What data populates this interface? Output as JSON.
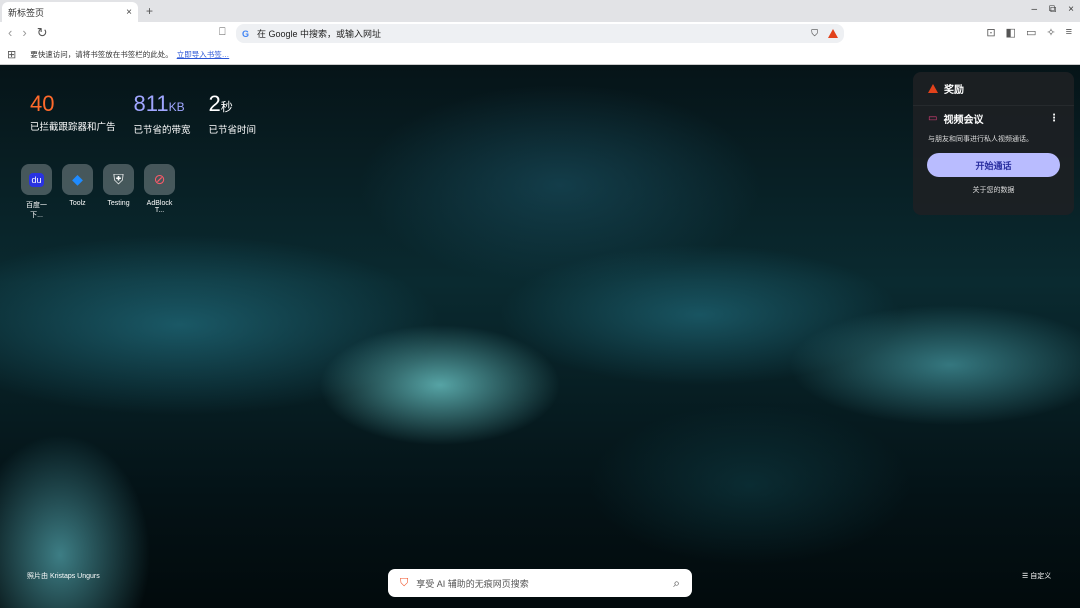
{
  "tab": {
    "title": "新标签页",
    "close": "×",
    "new": "+"
  },
  "window": {
    "min": "–",
    "restore": "⧉",
    "close": "×"
  },
  "omnibox": {
    "placeholder": "在 Google 中搜索，或输入网址",
    "g": "G"
  },
  "bookmarks": {
    "hint": "要快速访问，请将书签放在书签栏的此处。",
    "import": "立即导入书签…"
  },
  "stats": [
    {
      "value": "40",
      "unit": "",
      "label": "已拦截跟踪器和广告",
      "color": "#ff6a2b"
    },
    {
      "value": "811",
      "unit": "KB",
      "label": "已节省的带宽",
      "color": "#a0a6ff"
    },
    {
      "value": "2",
      "unit": "秒",
      "label": "已节省时间",
      "color": "#ffffff"
    }
  ],
  "tiles": [
    {
      "label": "百度一下...",
      "icon": "du"
    },
    {
      "label": "Toolz",
      "icon": "◆"
    },
    {
      "label": "Testing",
      "icon": "⛨"
    },
    {
      "label": "AdBlock T...",
      "icon": "⊘"
    }
  ],
  "rewards": {
    "title": "奖励"
  },
  "video": {
    "title": "视频会议",
    "desc": "与朋友和同事进行私人视频通话。",
    "button": "开始通话",
    "about": "关于您的数据",
    "menu": "⋮"
  },
  "credit": "照片由 Kristaps Ungurs",
  "search": {
    "placeholder": "享受 AI 辅助的无痕网页搜索"
  },
  "customize": "☰ 自定义"
}
